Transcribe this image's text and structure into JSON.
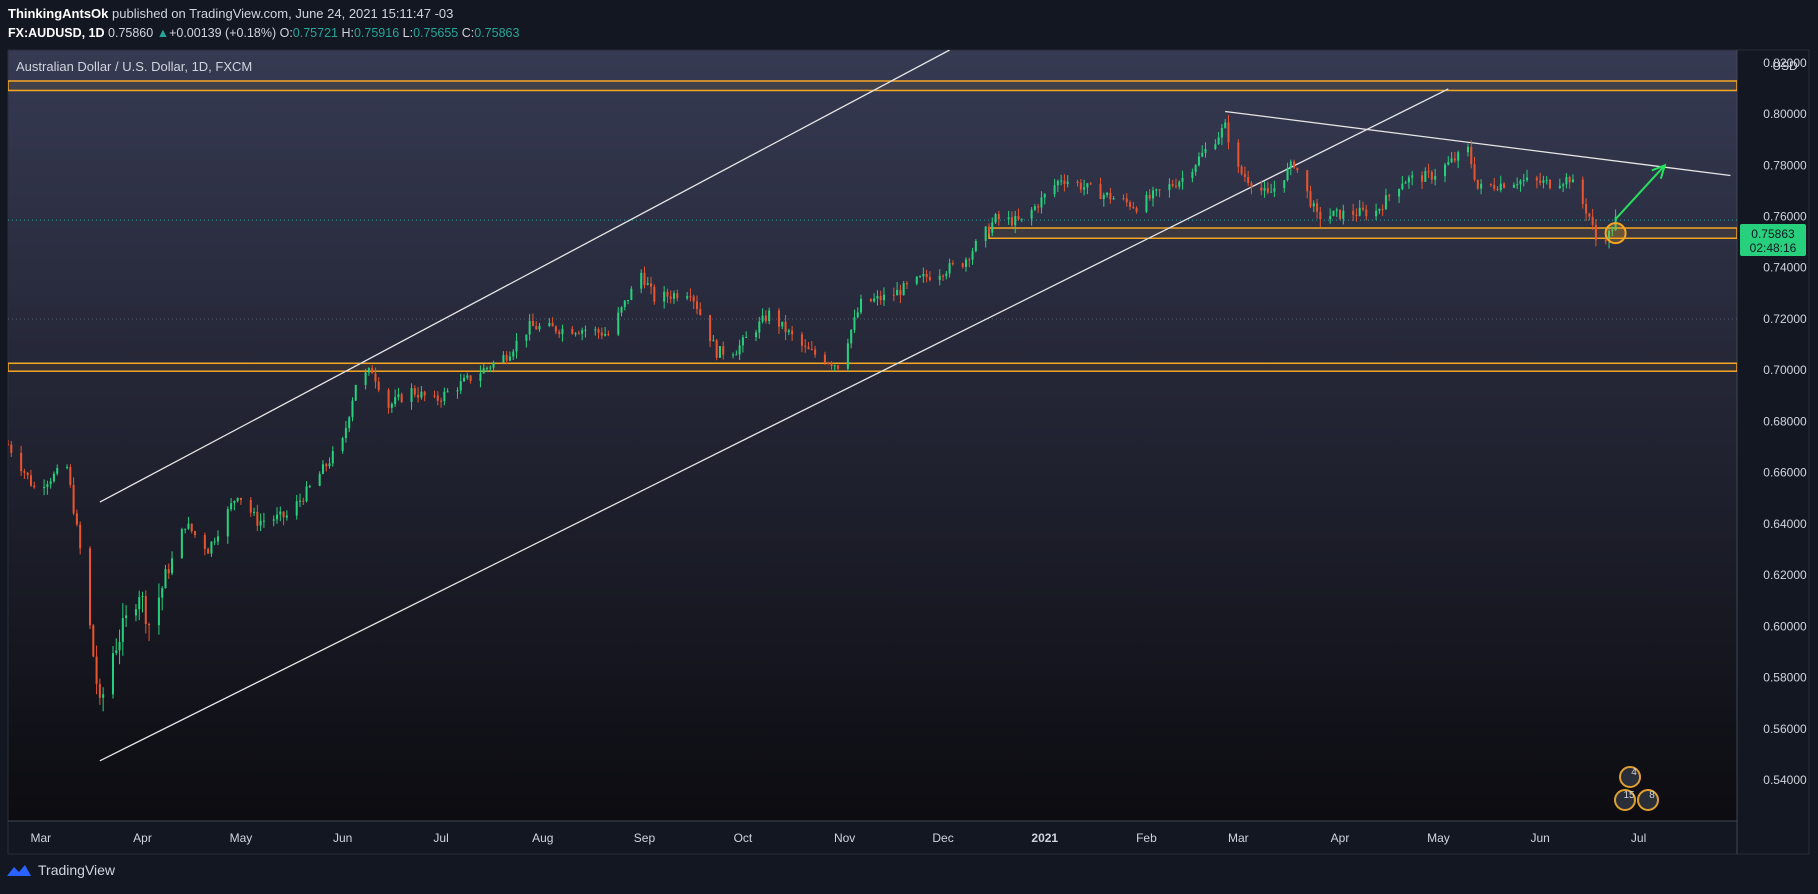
{
  "header": {
    "author": "ThinkingAntsOk",
    "published_text": "published on TradingView.com, June 24, 2021 15:11:47 -03",
    "symbol": "FX:AUDUSD, 1D",
    "last": "0.75860",
    "change_arrow": "▲",
    "change": "+0.00139 (+0.18%)",
    "o_label": "O:",
    "o": "0.75721",
    "h_label": "H:",
    "h": "0.75916",
    "l_label": "L:",
    "l": "0.75655",
    "c_label": "C:",
    "c": "0.75863"
  },
  "footer": {
    "brand": "TradingView",
    "logo_icon": "tradingview-logo-icon"
  },
  "colors": {
    "background_top": "#363a52",
    "background_bottom": "#0c0c11",
    "up": "#26d07c",
    "down": "#e8542e",
    "zone": "#f5a623",
    "trendline": "#e6e6e6",
    "price_tag": "#26d07c",
    "arrow": "#26e05c"
  },
  "chart_data": {
    "type": "candlestick",
    "title": "Australian Dollar / U.S. Dollar, 1D, FXCM",
    "currency": "USD",
    "x_range": [
      "2020-02-20",
      "2021-07-31"
    ],
    "ylim": [
      0.524,
      0.825
    ],
    "ytick_labels": [
      "0.82000",
      "0.80000",
      "0.78000",
      "0.76000",
      "0.74000",
      "0.72000",
      "0.70000",
      "0.68000",
      "0.66000",
      "0.64000",
      "0.62000",
      "0.60000",
      "0.58000",
      "0.56000",
      "0.54000"
    ],
    "yticks": [
      0.82,
      0.8,
      0.78,
      0.76,
      0.74,
      0.72,
      0.7,
      0.68,
      0.66,
      0.64,
      0.62,
      0.6,
      0.58,
      0.56,
      0.54
    ],
    "xtick_labels": [
      {
        "label": "Mar",
        "date": "2020-03-01",
        "bold": false
      },
      {
        "label": "Apr",
        "date": "2020-04-01",
        "bold": false
      },
      {
        "label": "May",
        "date": "2020-05-01",
        "bold": false
      },
      {
        "label": "Jun",
        "date": "2020-06-01",
        "bold": false
      },
      {
        "label": "Jul",
        "date": "2020-07-01",
        "bold": false
      },
      {
        "label": "Aug",
        "date": "2020-08-01",
        "bold": false
      },
      {
        "label": "Sep",
        "date": "2020-09-01",
        "bold": false
      },
      {
        "label": "Oct",
        "date": "2020-10-01",
        "bold": false
      },
      {
        "label": "Nov",
        "date": "2020-11-01",
        "bold": false
      },
      {
        "label": "Dec",
        "date": "2020-12-01",
        "bold": false
      },
      {
        "label": "2021",
        "date": "2021-01-01",
        "bold": true
      },
      {
        "label": "Feb",
        "date": "2021-02-01",
        "bold": false
      },
      {
        "label": "Mar",
        "date": "2021-03-01",
        "bold": false
      },
      {
        "label": "Apr",
        "date": "2021-04-01",
        "bold": false
      },
      {
        "label": "May",
        "date": "2021-05-01",
        "bold": false
      },
      {
        "label": "Jun",
        "date": "2021-06-01",
        "bold": false
      },
      {
        "label": "Jul",
        "date": "2021-07-01",
        "bold": false
      }
    ],
    "price_path": [
      [
        "2020-02-20",
        0.671
      ],
      [
        "2020-02-28",
        0.654
      ],
      [
        "2020-03-09",
        0.662
      ],
      [
        "2020-03-13",
        0.63
      ],
      [
        "2020-03-19",
        0.568
      ],
      [
        "2020-03-23",
        0.59
      ],
      [
        "2020-03-31",
        0.614
      ],
      [
        "2020-04-03",
        0.601
      ],
      [
        "2020-04-14",
        0.64
      ],
      [
        "2020-04-21",
        0.63
      ],
      [
        "2020-04-30",
        0.652
      ],
      [
        "2020-05-06",
        0.641
      ],
      [
        "2020-05-15",
        0.643
      ],
      [
        "2020-05-22",
        0.654
      ],
      [
        "2020-06-01",
        0.672
      ],
      [
        "2020-06-05",
        0.695
      ],
      [
        "2020-06-10",
        0.7
      ],
      [
        "2020-06-15",
        0.686
      ],
      [
        "2020-06-22",
        0.692
      ],
      [
        "2020-06-29",
        0.688
      ],
      [
        "2020-07-10",
        0.697
      ],
      [
        "2020-07-21",
        0.706
      ],
      [
        "2020-07-28",
        0.717
      ],
      [
        "2020-08-07",
        0.716
      ],
      [
        "2020-08-14",
        0.716
      ],
      [
        "2020-08-21",
        0.714
      ],
      [
        "2020-08-31",
        0.738
      ],
      [
        "2020-09-04",
        0.728
      ],
      [
        "2020-09-15",
        0.731
      ],
      [
        "2020-09-23",
        0.707
      ],
      [
        "2020-09-29",
        0.708
      ],
      [
        "2020-10-09",
        0.722
      ],
      [
        "2020-10-20",
        0.708
      ],
      [
        "2020-10-30",
        0.702
      ],
      [
        "2020-11-06",
        0.726
      ],
      [
        "2020-11-15",
        0.729
      ],
      [
        "2020-11-25",
        0.736
      ],
      [
        "2020-12-07",
        0.742
      ],
      [
        "2020-12-17",
        0.759
      ],
      [
        "2020-12-25",
        0.758
      ],
      [
        "2021-01-06",
        0.775
      ],
      [
        "2021-01-18",
        0.769
      ],
      [
        "2021-01-29",
        0.764
      ],
      [
        "2021-02-12",
        0.775
      ],
      [
        "2021-02-25",
        0.795
      ],
      [
        "2021-03-01",
        0.778
      ],
      [
        "2021-03-10",
        0.768
      ],
      [
        "2021-03-18",
        0.781
      ],
      [
        "2021-03-25",
        0.76
      ],
      [
        "2021-04-02",
        0.761
      ],
      [
        "2021-04-12",
        0.762
      ],
      [
        "2021-04-20",
        0.774
      ],
      [
        "2021-04-29",
        0.776
      ],
      [
        "2021-05-10",
        0.786
      ],
      [
        "2021-05-13",
        0.771
      ],
      [
        "2021-05-25",
        0.774
      ],
      [
        "2021-06-04",
        0.773
      ],
      [
        "2021-06-10",
        0.775
      ],
      [
        "2021-06-16",
        0.76
      ],
      [
        "2021-06-18",
        0.751
      ],
      [
        "2021-06-22",
        0.753
      ],
      [
        "2021-06-24",
        0.7586
      ]
    ],
    "last_price_label": "0.75863",
    "countdown_label": "02:48:16",
    "last_price": 0.75863,
    "horizontal_lines": [
      {
        "name": "upper-dotted",
        "y": 0.7586,
        "style": "dotted",
        "color": "#26a69a"
      },
      {
        "name": "mid-dotted",
        "y": 0.72,
        "style": "dotted",
        "color": "#55596e"
      }
    ],
    "zones": [
      {
        "name": "resistance-zone-top",
        "y_low": 0.8092,
        "y_high": 0.8129
      },
      {
        "name": "support-zone-075",
        "y_low": 0.7515,
        "y_high": 0.7555,
        "start": "2020-12-15"
      },
      {
        "name": "support-zone-070",
        "y_low": 0.6996,
        "y_high": 0.7027
      }
    ],
    "trendlines": [
      {
        "name": "channel-upper",
        "x1": "2020-03-19",
        "y1": 0.6485,
        "x2": "2020-12-03",
        "y2": 0.825
      },
      {
        "name": "channel-lower",
        "x1": "2020-03-19",
        "y1": 0.5475,
        "x2": "2021-05-04",
        "y2": 0.8098
      },
      {
        "name": "descending-resistance",
        "x1": "2021-02-25",
        "y1": 0.801,
        "x2": "2021-07-29",
        "y2": 0.776
      }
    ],
    "projection_arrow": {
      "x1": "2021-06-24",
      "y1": 0.759,
      "x2": "2021-07-09",
      "y2": 0.78
    },
    "highlight_circle": {
      "date": "2021-06-24",
      "y": 0.7535
    },
    "event_badges": [
      {
        "date": "2021-06-27",
        "label": "4"
      },
      {
        "date": "2021-06-25",
        "label": "15"
      },
      {
        "date": "2021-06-28",
        "label": "8"
      }
    ]
  }
}
